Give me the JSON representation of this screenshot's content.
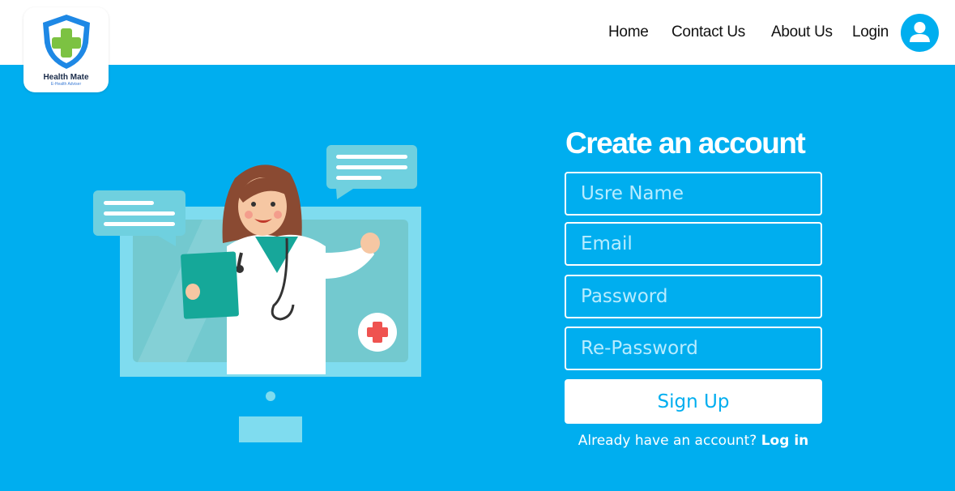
{
  "brand": {
    "name": "Health Mate",
    "tagline": "E-Health Adviser"
  },
  "nav": {
    "home": "Home",
    "contact": "Contact Us",
    "about": "About Us",
    "login": "Login"
  },
  "colors": {
    "primary": "#00aeef",
    "white": "#ffffff",
    "shield_blue": "#1e88e5",
    "cross_green": "#7cc242"
  },
  "icons": {
    "avatar": "user-icon",
    "logo": "shield-cross-icon"
  },
  "form": {
    "title": "Create an account",
    "username_placeholder": "Usre Name",
    "email_placeholder": "Email",
    "password_placeholder": "Password",
    "repassword_placeholder": "Re-Password",
    "submit_label": "Sign Up",
    "already_text": "Already have an account?",
    "login_link": "Log in"
  }
}
